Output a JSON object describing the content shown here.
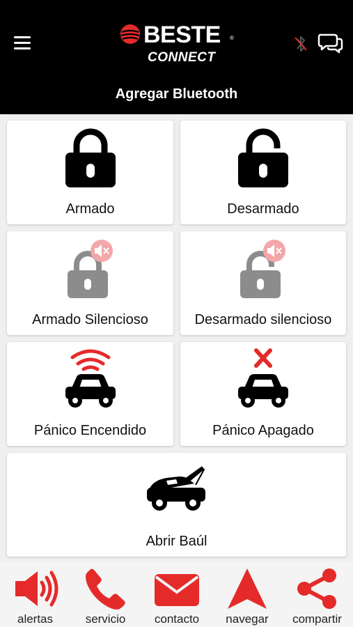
{
  "header": {
    "brand": "BESTE",
    "brand_sub": "CONNECT",
    "registered_mark": "®",
    "title": "Agregar Bluetooth"
  },
  "colors": {
    "accent_red": "#e52a2a",
    "header_bg": "#000000",
    "grey_icon": "#8c8c8c",
    "muted_badge": "#f2a7aa"
  },
  "actions": [
    {
      "label": "Armado",
      "icon": "lock-closed-icon"
    },
    {
      "label": "Desarmado",
      "icon": "lock-open-icon"
    },
    {
      "label": "Armado Silencioso",
      "icon": "lock-closed-muted-icon"
    },
    {
      "label": "Desarmado silencioso",
      "icon": "lock-open-muted-icon"
    },
    {
      "label": "Pánico Encendido",
      "icon": "car-alarm-on-icon"
    },
    {
      "label": "Pánico Apagado",
      "icon": "car-alarm-off-icon"
    },
    {
      "label": "Abrir Baúl",
      "icon": "car-trunk-icon"
    }
  ],
  "bottom_nav": [
    {
      "label": "alertas",
      "icon": "speaker-icon"
    },
    {
      "label": "servicio",
      "icon": "phone-icon"
    },
    {
      "label": "contacto",
      "icon": "mail-icon"
    },
    {
      "label": "navegar",
      "icon": "navigation-arrow-icon"
    },
    {
      "label": "compartir",
      "icon": "share-icon"
    }
  ]
}
